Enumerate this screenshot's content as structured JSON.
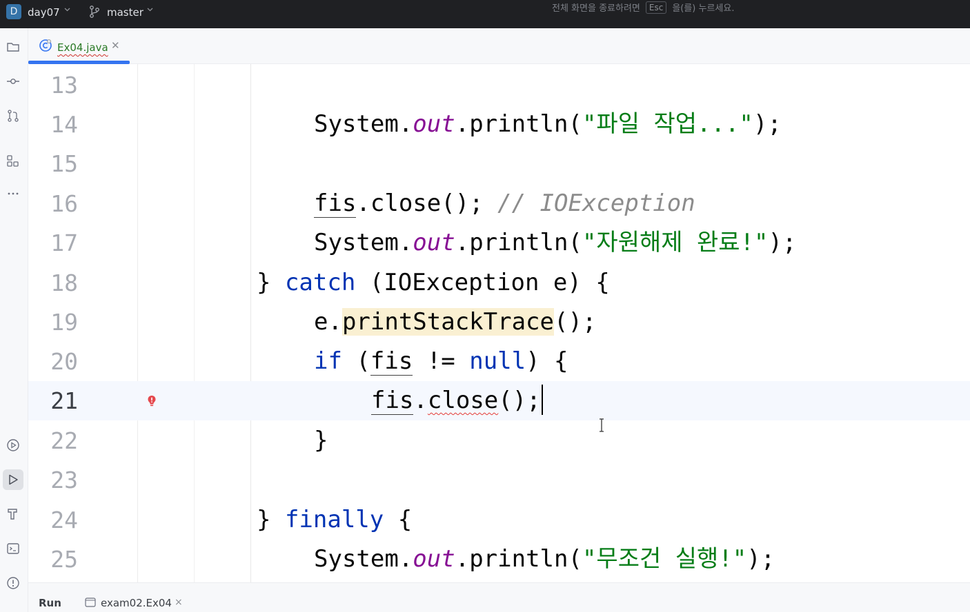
{
  "titlebar": {
    "project_badge": "D",
    "project_name": "day07",
    "branch_name": "master",
    "fullscreen_notice_before": "전체 화면을 종료하려면",
    "esc_key": "Esc",
    "fullscreen_notice_after": "을(를) 누르세요."
  },
  "toolstrip": {
    "top_icons": [
      "folder-icon",
      "commit-icon",
      "pull-requests-icon",
      "structure-icon",
      "more-icon"
    ],
    "bottom_icons": [
      "services-icon",
      "run-icon",
      "build-icon",
      "terminal-icon",
      "problems-icon"
    ],
    "active": "run-icon"
  },
  "tabs": [
    {
      "label": "Ex04.java",
      "icon": "java-class-icon",
      "active": true,
      "error_underline": true
    }
  ],
  "editor": {
    "current_line": 21,
    "lines": [
      {
        "number": "13"
      },
      {
        "number": "14",
        "text": "System.out.println(\"파일 작업...\");"
      },
      {
        "number": "15"
      },
      {
        "number": "16",
        "text": "fis.close(); // IOException"
      },
      {
        "number": "17",
        "text": "System.out.println(\"자원해제 완료!\");"
      },
      {
        "number": "18",
        "text": "} catch (IOException e) {"
      },
      {
        "number": "19",
        "text": "e.printStackTrace();"
      },
      {
        "number": "20",
        "text": "if (fis != null) {"
      },
      {
        "number": "21",
        "text": "fis.close();",
        "gutter_icon": "error-bulb-icon"
      },
      {
        "number": "22",
        "text": "}"
      },
      {
        "number": "23"
      },
      {
        "number": "24",
        "text": "} finally {"
      },
      {
        "number": "25",
        "text": "System.out.println(\"무조건 실행!\");"
      }
    ],
    "tokens": {
      "l14": {
        "a": "System.",
        "b": "out",
        "c": ".println(",
        "d": "\"파일 작업...\"",
        "e": ");"
      },
      "l16": {
        "a": "fis",
        "b": ".close(); ",
        "c": "// IOException"
      },
      "l17": {
        "a": "System.",
        "b": "out",
        "c": ".println(",
        "d": "\"자원해제 완료!\"",
        "e": ");"
      },
      "l18": {
        "a": "} ",
        "b": "catch",
        "c": " (IOException e) {"
      },
      "l19": {
        "a": "e.",
        "b": "printStackTrace",
        "c": "();"
      },
      "l20": {
        "a": "if",
        "b": " (",
        "c": "fis",
        "d": " != ",
        "e": "null",
        "f": ") {"
      },
      "l21": {
        "a": "fis",
        "b": ".",
        "c": "close",
        "d": "();"
      },
      "l22": {
        "a": "}"
      },
      "l24": {
        "a": "} ",
        "b": "finally",
        "c": " {"
      },
      "l25": {
        "a": "System.",
        "b": "out",
        "c": ".println(",
        "d": "\"무조건 실행!\"",
        "e": ");"
      }
    }
  },
  "bottombar": {
    "run_label": "Run",
    "run_config": "exam02.Ex04",
    "close_glyph": "×"
  },
  "colors": {
    "keyword": "#0033b3",
    "string": "#067d17",
    "static_field": "#871094",
    "comment": "#8c8c8c",
    "accent": "#3574f0",
    "error": "#e53935"
  }
}
